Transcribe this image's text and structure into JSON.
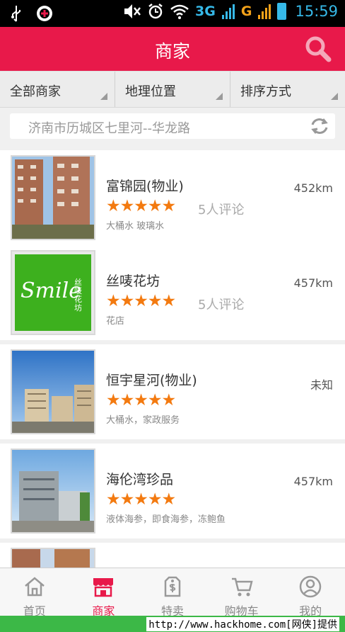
{
  "status_bar": {
    "network_3g": "3G",
    "network_g": "G",
    "time": "15:59"
  },
  "header": {
    "title": "商家"
  },
  "filters": [
    {
      "label": "全部商家"
    },
    {
      "label": "地理位置"
    },
    {
      "label": "排序方式"
    }
  ],
  "location": {
    "text": "济南市历城区七里河--华龙路"
  },
  "merchants": [
    {
      "name": "富锦园(物业)",
      "stars": "★★★★★",
      "rating": 5,
      "reviews": "5人评论",
      "tags": "大桶水  玻璃水",
      "distance": "452km"
    },
    {
      "name": "丝唛花坊",
      "stars": "★★★★★",
      "rating": 5,
      "reviews": "5人评论",
      "tags": "花店",
      "distance": "457km",
      "logo_text": "Smile",
      "logo_small": "丝唛花坊"
    },
    {
      "name": "恒宇星河(物业)",
      "stars": "★★★★★",
      "rating": 5,
      "reviews": "",
      "tags": "大桶水，家政服务",
      "distance": "未知"
    },
    {
      "name": "海伦湾珍品",
      "stars": "★★★★★",
      "rating": 5,
      "reviews": "",
      "tags": "液体海参，即食海参，冻鲍鱼",
      "distance": "457km"
    }
  ],
  "bottom_nav": [
    {
      "label": "首页",
      "icon": "home-icon"
    },
    {
      "label": "商家",
      "icon": "store-icon",
      "active": true
    },
    {
      "label": "特卖",
      "icon": "sale-tag-icon"
    },
    {
      "label": "购物车",
      "icon": "cart-icon"
    },
    {
      "label": "我的",
      "icon": "user-icon"
    }
  ],
  "watermark": "http://www.hackhome.com[网侠]提供",
  "colors": {
    "accent": "#e8194a",
    "star": "#f37a10"
  }
}
